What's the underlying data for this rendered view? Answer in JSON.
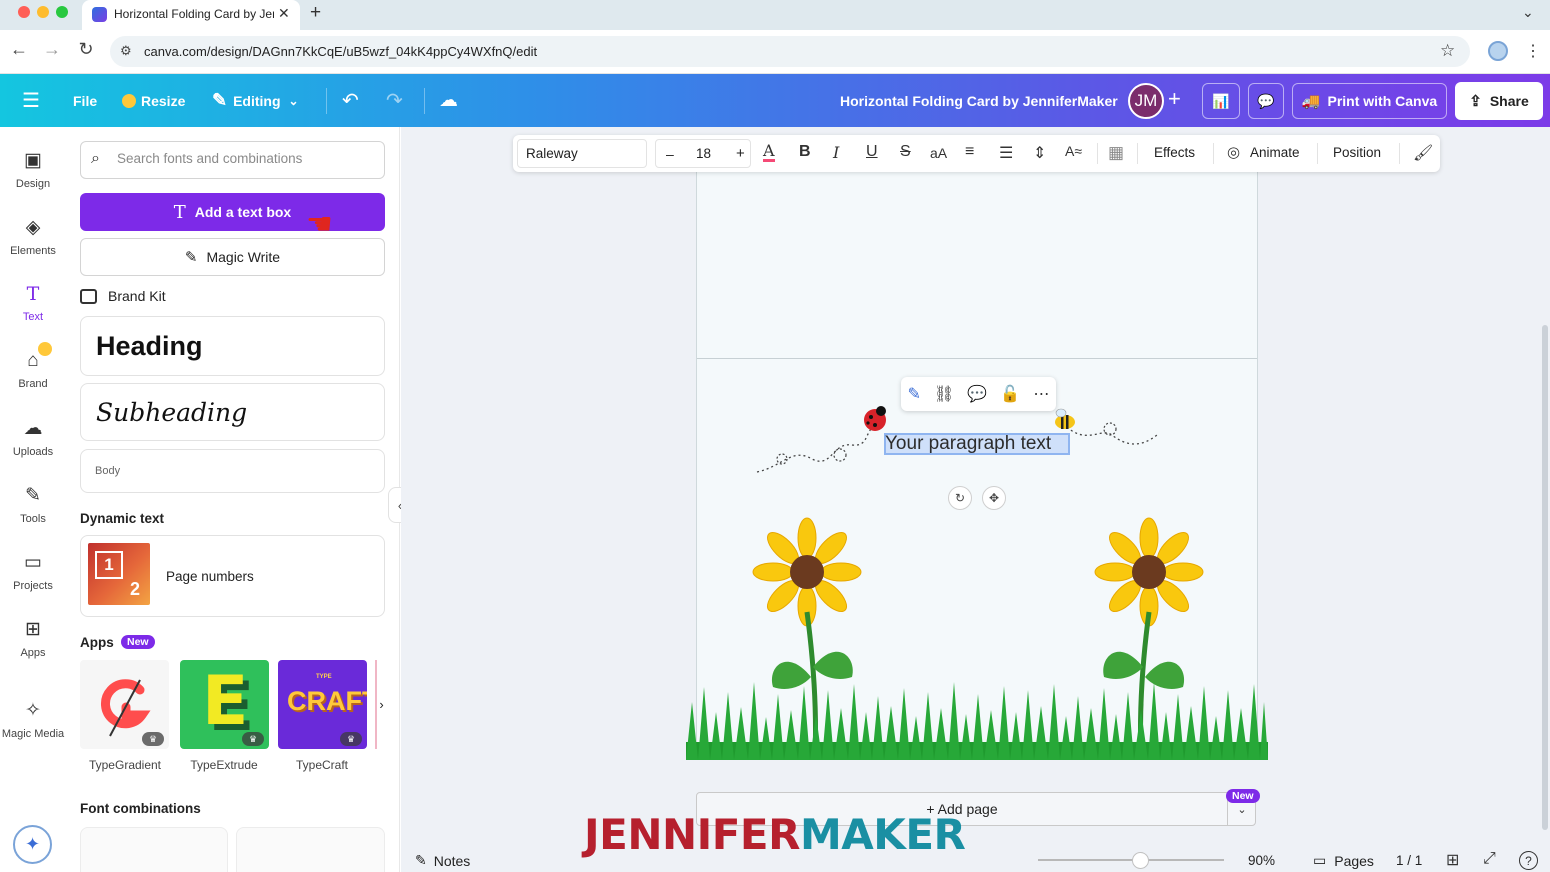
{
  "browser": {
    "tab_title": "Horizontal Folding Card by JenniferMaker",
    "url": "canva.com/design/DAGnn7KkCqE/uB5wzf_04kK4ppCy4WXfnQ/edit"
  },
  "topbar": {
    "file": "File",
    "resize": "Resize",
    "editing": "Editing",
    "doc_title": "Horizontal Folding Card by JenniferMaker",
    "avatar_initials": "JM",
    "print": "Print with Canva",
    "share": "Share"
  },
  "rail": {
    "items": [
      {
        "label": "Design",
        "icon": "design-icon"
      },
      {
        "label": "Elements",
        "icon": "elements-icon"
      },
      {
        "label": "Text",
        "icon": "text-icon"
      },
      {
        "label": "Brand",
        "icon": "brand-icon"
      },
      {
        "label": "Uploads",
        "icon": "uploads-icon"
      },
      {
        "label": "Tools",
        "icon": "tools-icon"
      },
      {
        "label": "Projects",
        "icon": "projects-icon"
      },
      {
        "label": "Apps",
        "icon": "apps-icon"
      },
      {
        "label": "Magic Media",
        "icon": "magic-media-icon"
      }
    ]
  },
  "panel": {
    "search_placeholder": "Search fonts and combinations",
    "add_text_box": "Add a text box",
    "magic_write": "Magic Write",
    "brand_kit": "Brand Kit",
    "heading": "Heading",
    "subheading": "Subheading",
    "body": "Body",
    "dynamic_text": "Dynamic text",
    "page_numbers": "Page numbers",
    "page_thumb_1": "1",
    "page_thumb_2": "2",
    "apps": "Apps",
    "apps_badge": "New",
    "app_cards": [
      {
        "name": "TypeGradient"
      },
      {
        "name": "TypeExtrude",
        "thumb_text": "E"
      },
      {
        "name": "TypeCraft",
        "thumb_text": "CRAFT",
        "thumb_small": "TYPE"
      }
    ],
    "font_combinations": "Font combinations"
  },
  "context_toolbar": {
    "font": "Raleway",
    "size_minus": "–",
    "size": "18",
    "size_plus": "+",
    "case": "aA",
    "effects": "Effects",
    "animate": "Animate",
    "position": "Position"
  },
  "canvas": {
    "paragraph": "Your paragraph text",
    "add_page": "+ Add page",
    "add_page_badge": "New"
  },
  "footer": {
    "notes": "Notes",
    "zoom": "90%",
    "zoom_level": 0.55,
    "pages": "Pages",
    "page_count": "1 / 1"
  },
  "watermark": {
    "part1": "JENNIFER",
    "part2": "MAKER"
  },
  "colors": {
    "accent": "#7d2ae8",
    "watermark_red": "#b6202e",
    "watermark_teal": "#1a8fa3"
  }
}
